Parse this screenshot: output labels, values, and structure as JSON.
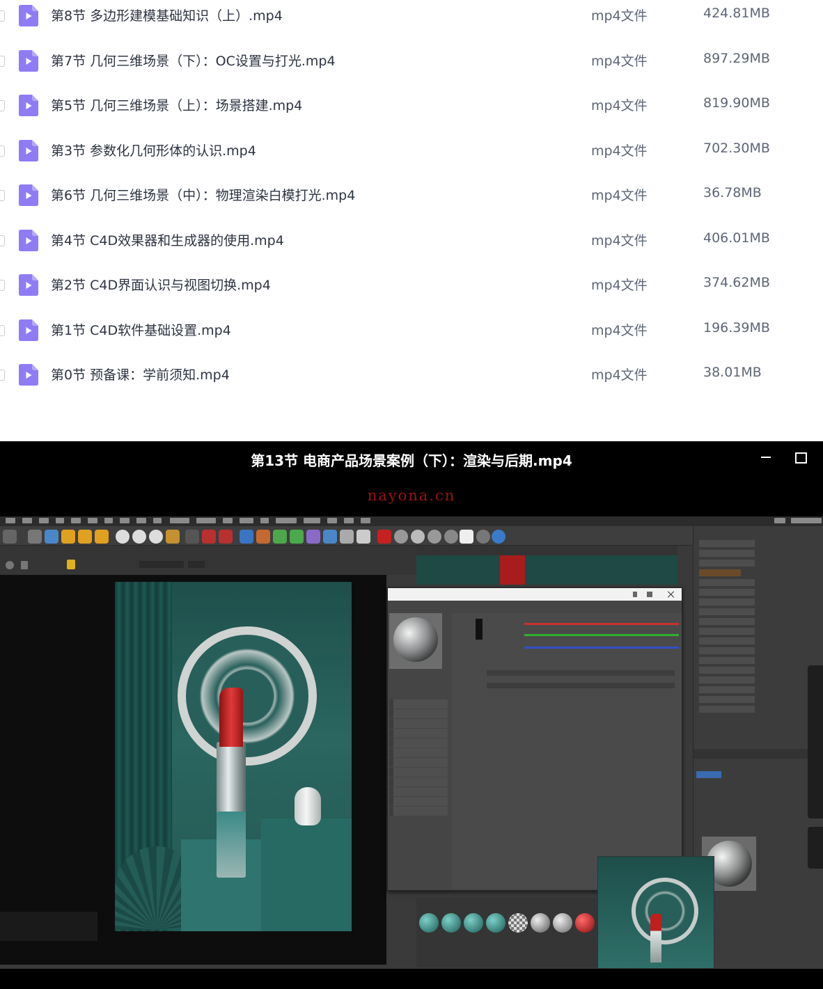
{
  "file_list": {
    "rows": [
      {
        "name": "第8节 多边形建模基础知识（上）.mp4",
        "type": "mp4文件",
        "size": "424.81MB"
      },
      {
        "name": "第7节 几何三维场景（下）：OC设置与打光.mp4",
        "type": "mp4文件",
        "size": "897.29MB"
      },
      {
        "name": "第5节 几何三维场景（上）：场景搭建.mp4",
        "type": "mp4文件",
        "size": "819.90MB"
      },
      {
        "name": "第3节 参数化几何形体的认识.mp4",
        "type": "mp4文件",
        "size": "702.30MB"
      },
      {
        "name": "第6节 几何三维场景（中）：物理渲染白模打光.mp4",
        "type": "mp4文件",
        "size": "36.78MB"
      },
      {
        "name": "第4节 C4D效果器和生成器的使用.mp4",
        "type": "mp4文件",
        "size": "406.01MB"
      },
      {
        "name": "第2节 C4D界面认识与视图切换.mp4",
        "type": "mp4文件",
        "size": "374.62MB"
      },
      {
        "name": "第1节 C4D软件基础设置.mp4",
        "type": "mp4文件",
        "size": "196.39MB"
      },
      {
        "name": "第0节 预备课：学前须知.mp4",
        "type": "mp4文件",
        "size": "38.01MB"
      }
    ]
  },
  "player": {
    "title": "第13节 电商产品场景案例（下）：渲染与后期.mp4",
    "watermark": "nayona.cn",
    "colors": {
      "background": "#000000",
      "watermark": "#9b1313"
    }
  },
  "colors": {
    "file_icon": "#8f7cf5",
    "file_text": "#2d3340",
    "meta_text": "#5e6675"
  }
}
